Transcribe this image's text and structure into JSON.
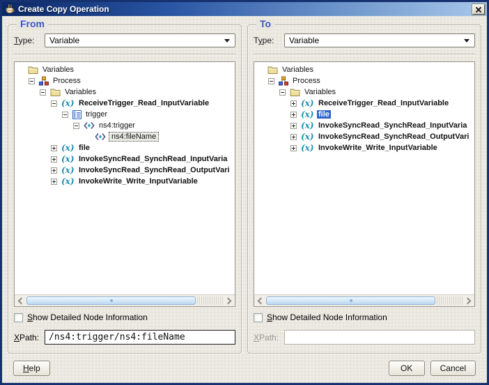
{
  "window": {
    "title": "Create Copy Operation"
  },
  "panels": {
    "from": {
      "legend": "From",
      "type_label": {
        "pre": "",
        "key": "T",
        "rest": "ype:"
      },
      "type_value": "Variable",
      "tree": [
        {
          "label": "Variables",
          "icon": "folder-icon",
          "depth": 0,
          "expander": "none"
        },
        {
          "label": "Process",
          "icon": "process-icon",
          "depth": 1,
          "expander": "minus"
        },
        {
          "label": "Variables",
          "icon": "folder-icon",
          "depth": 2,
          "expander": "minus"
        },
        {
          "label": "ReceiveTrigger_Read_InputVariable",
          "icon": "variable-icon",
          "depth": 3,
          "expander": "minus",
          "bold": true
        },
        {
          "label": "trigger",
          "icon": "message-icon",
          "depth": 4,
          "expander": "minus"
        },
        {
          "label": "ns4:trigger",
          "icon": "element-icon",
          "depth": 5,
          "expander": "minus"
        },
        {
          "label": "ns4:fileName",
          "icon": "element-icon",
          "depth": 6,
          "expander": "none",
          "focus": true
        },
        {
          "label": "file",
          "icon": "variable-icon",
          "depth": 3,
          "expander": "plus",
          "bold": true
        },
        {
          "label": "InvokeSyncRead_SynchRead_InputVaria",
          "icon": "variable-icon",
          "depth": 3,
          "expander": "plus",
          "bold": true
        },
        {
          "label": "InvokeSyncRead_SynchRead_OutputVari",
          "icon": "variable-icon",
          "depth": 3,
          "expander": "plus",
          "bold": true
        },
        {
          "label": "InvokeWrite_Write_InputVariable",
          "icon": "variable-icon",
          "depth": 3,
          "expander": "plus",
          "bold": true
        }
      ],
      "checkbox_label": {
        "pre": "",
        "key": "S",
        "rest": "how Detailed Node Information"
      },
      "checkbox_checked": false,
      "xpath_label": {
        "pre": "",
        "key": "X",
        "rest": "Path:"
      },
      "xpath_value": "/ns4:trigger/ns4:fileName"
    },
    "to": {
      "legend": "To",
      "type_label": {
        "pre": "T",
        "key": "y",
        "rest": "pe:"
      },
      "type_value": "Variable",
      "tree": [
        {
          "label": "Variables",
          "icon": "folder-icon",
          "depth": 0,
          "expander": "none"
        },
        {
          "label": "Process",
          "icon": "process-icon",
          "depth": 1,
          "expander": "minus"
        },
        {
          "label": "Variables",
          "icon": "folder-icon",
          "depth": 2,
          "expander": "minus"
        },
        {
          "label": "ReceiveTrigger_Read_InputVariable",
          "icon": "variable-icon",
          "depth": 3,
          "expander": "plus",
          "bold": true
        },
        {
          "label": "file",
          "icon": "variable-icon",
          "depth": 3,
          "expander": "plus",
          "bold": true,
          "selected": true
        },
        {
          "label": "InvokeSyncRead_SynchRead_InputVaria",
          "icon": "variable-icon",
          "depth": 3,
          "expander": "plus",
          "bold": true
        },
        {
          "label": "InvokeSyncRead_SynchRead_OutputVari",
          "icon": "variable-icon",
          "depth": 3,
          "expander": "plus",
          "bold": true
        },
        {
          "label": "InvokeWrite_Write_InputVariable",
          "icon": "variable-icon",
          "depth": 3,
          "expander": "plus",
          "bold": true
        }
      ],
      "checkbox_label": {
        "pre": "",
        "key": "S",
        "rest": "how Detailed Node Information"
      },
      "checkbox_checked": false,
      "xpath_label": {
        "pre": "",
        "key": "X",
        "rest": "Path:"
      },
      "xpath_value": ""
    }
  },
  "buttons": {
    "help": {
      "pre": "",
      "key": "H",
      "rest": "elp"
    },
    "ok": "OK",
    "cancel": "Cancel"
  }
}
